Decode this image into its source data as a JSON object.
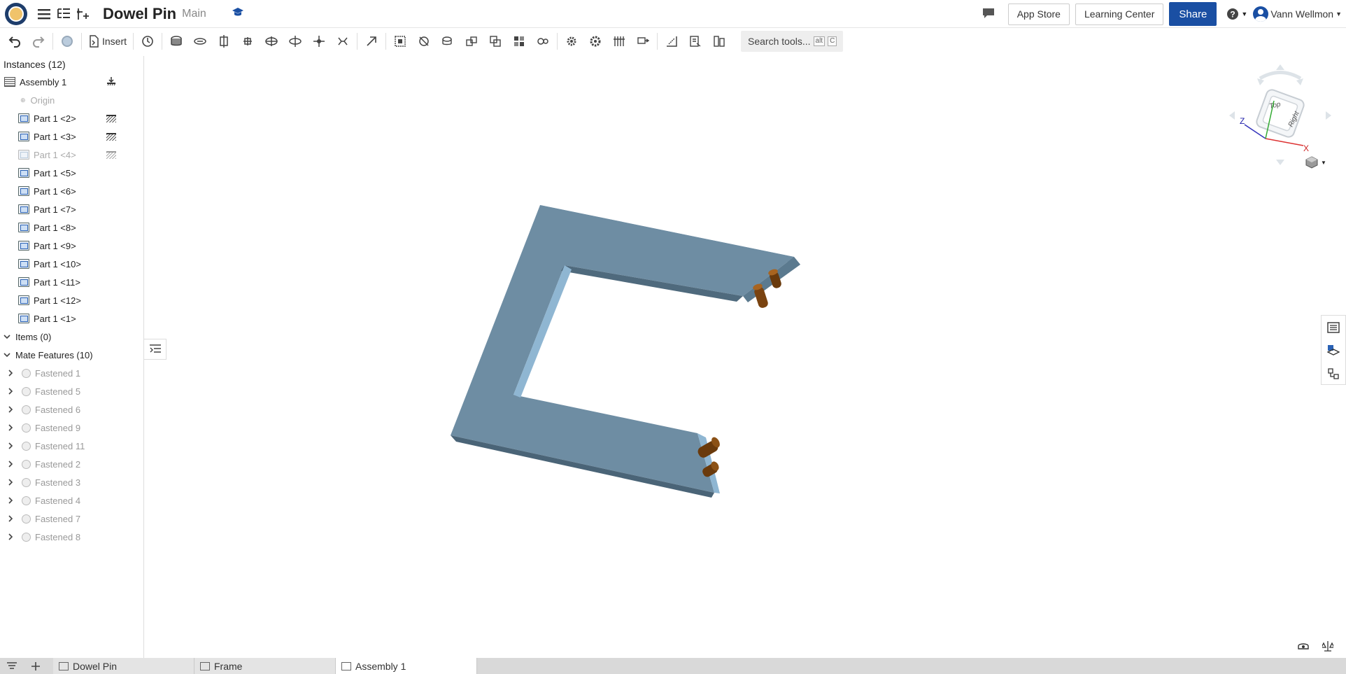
{
  "header": {
    "doc_title": "Dowel Pin",
    "branch": "Main",
    "app_store": "App Store",
    "learning_center": "Learning Center",
    "share": "Share",
    "user_name": "Vann Wellmon"
  },
  "toolbar": {
    "insert_label": "Insert",
    "search_placeholder": "Search tools...",
    "search_kbd_1": "alt",
    "search_kbd_2": "C"
  },
  "sidebar": {
    "instances_header": "Instances (12)",
    "assembly": "Assembly 1",
    "origin": "Origin",
    "parts": [
      {
        "label": "Part 1 <2>",
        "fixed": true,
        "dim": false
      },
      {
        "label": "Part 1 <3>",
        "fixed": true,
        "dim": false
      },
      {
        "label": "Part 1 <4>",
        "fixed": true,
        "dim": true
      },
      {
        "label": "Part 1 <5>",
        "fixed": false,
        "dim": false
      },
      {
        "label": "Part 1 <6>",
        "fixed": false,
        "dim": false
      },
      {
        "label": "Part 1 <7>",
        "fixed": false,
        "dim": false
      },
      {
        "label": "Part 1 <8>",
        "fixed": false,
        "dim": false
      },
      {
        "label": "Part 1 <9>",
        "fixed": false,
        "dim": false
      },
      {
        "label": "Part 1 <10>",
        "fixed": false,
        "dim": false
      },
      {
        "label": "Part 1 <11>",
        "fixed": false,
        "dim": false
      },
      {
        "label": "Part 1 <12>",
        "fixed": false,
        "dim": false
      },
      {
        "label": "Part 1 <1>",
        "fixed": false,
        "dim": false
      }
    ],
    "items_header": "Items (0)",
    "mate_header": "Mate Features (10)",
    "mates": [
      "Fastened 1",
      "Fastened 5",
      "Fastened 6",
      "Fastened 9",
      "Fastened 11",
      "Fastened 2",
      "Fastened 3",
      "Fastened 4",
      "Fastened 7",
      "Fastened 8"
    ]
  },
  "viewcube": {
    "top": "Top",
    "right": "Right",
    "axis_x": "X",
    "axis_z": "Z"
  },
  "tabs": [
    "Dowel Pin",
    "Frame",
    "Assembly 1"
  ],
  "active_tab": "Assembly 1",
  "colors": {
    "accent": "#1a4fa3",
    "frame_part": "#6f8da3",
    "dowel_pin": "#7a4310"
  }
}
